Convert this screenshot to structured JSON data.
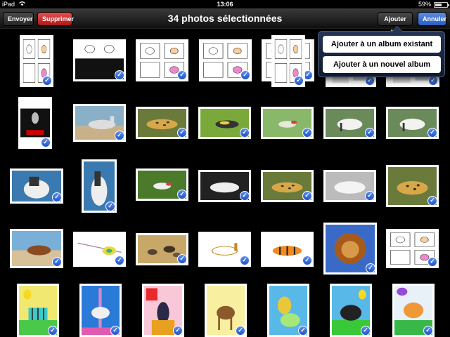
{
  "status": {
    "device": "iPad",
    "time": "13:06",
    "battery": "59%",
    "battery_level": 0.59
  },
  "toolbar": {
    "send_label": "Envoyer",
    "delete_label": "Supprimer",
    "title": "34 photos sélectionnées",
    "add_label": "Ajouter à…",
    "cancel_label": "Annuler"
  },
  "popover": {
    "items": [
      {
        "label": "Ajouter à un album existant"
      },
      {
        "label": "Ajouter à un nouvel album"
      }
    ]
  },
  "photos": [
    {
      "kind": "comic"
    },
    {
      "kind": "comic-dark"
    },
    {
      "kind": "comic"
    },
    {
      "kind": "comic"
    },
    {
      "kind": "comic"
    },
    {
      "kind": "comic"
    },
    {
      "kind": "partial"
    },
    {
      "kind": "partial"
    },
    {
      "kind": "poster"
    },
    {
      "kind": "horse-photo"
    },
    {
      "kind": "leopard"
    },
    {
      "kind": "insect"
    },
    {
      "kind": "bird"
    },
    {
      "kind": "horse-white"
    },
    {
      "kind": "horse-white"
    },
    {
      "kind": "horse-girl"
    },
    {
      "kind": "horse-girl"
    },
    {
      "kind": "bird-green"
    },
    {
      "kind": "wolf"
    },
    {
      "kind": "leopard"
    },
    {
      "kind": "cat-white"
    },
    {
      "kind": "leopard"
    },
    {
      "kind": "horse-brown"
    },
    {
      "kind": "drawing-lines"
    },
    {
      "kind": "battle"
    },
    {
      "kind": "horse-drawing"
    },
    {
      "kind": "tiger-drawing"
    },
    {
      "kind": "lion"
    },
    {
      "kind": "comic"
    },
    {
      "kind": "zebra-draw"
    },
    {
      "kind": "carousel-draw"
    },
    {
      "kind": "parrot-draw"
    },
    {
      "kind": "deer-draw"
    },
    {
      "kind": "lion-draw"
    },
    {
      "kind": "cow-draw"
    },
    {
      "kind": "unicorn-draw"
    }
  ],
  "colors": {
    "accent": "#2a5fc4",
    "delete": "#b01818",
    "check": "#2154c8"
  }
}
